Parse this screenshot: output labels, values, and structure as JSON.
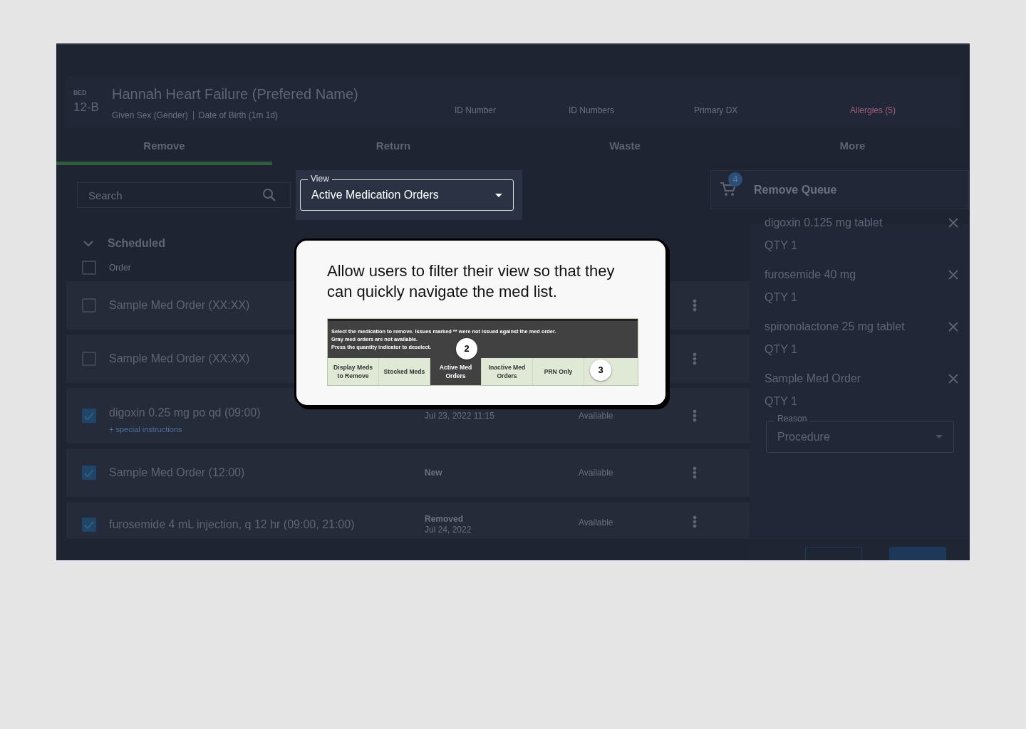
{
  "patient": {
    "bed_label": "BED",
    "bed": "12-B",
    "name": "Hannah Heart Failure (Prefered Name)",
    "sex": "Given Sex (Gender)",
    "dob": "Date of Birth (1m 1d)",
    "fields": [
      "ID Number",
      "ID Numbers",
      "Primary DX"
    ],
    "allergies": "Allergies (5)"
  },
  "tabs": [
    {
      "label": "Remove",
      "selected": true
    },
    {
      "label": "Return",
      "selected": false
    },
    {
      "label": "Waste",
      "selected": false
    },
    {
      "label": "More",
      "selected": false
    }
  ],
  "search": {
    "placeholder": "Search"
  },
  "view_filter": {
    "label": "View",
    "value": "Active Medication Orders"
  },
  "group": {
    "title": "Scheduled",
    "expanded": true,
    "column": "Order",
    "checked": false
  },
  "orders": [
    {
      "name": "Sample Med Order (XX:XX)",
      "checked": false
    },
    {
      "name": "Sample Med Order (XX:XX)",
      "checked": false
    },
    {
      "name": "digoxin 0.25 mg po qd (09:00)",
      "note": "+ special instructions",
      "checked": true,
      "date_lines": [
        "Jul 23, 2022 11:15"
      ],
      "availability": "Available"
    },
    {
      "name": "Sample Med Order (12:00)",
      "checked": true,
      "status": "New",
      "availability": "Available"
    },
    {
      "name": "furosemide 4 mL injection, q 12 hr (09:00, 21:00)",
      "checked": true,
      "status": "Removed",
      "date_lines": [
        "Jul 24, 2022"
      ],
      "availability": "Available"
    }
  ],
  "queue": {
    "count": "4",
    "title": "Remove Queue",
    "items": [
      {
        "name": "digoxin 0.125 mg tablet",
        "qty": "QTY 1"
      },
      {
        "name": "furosemide 40 mg",
        "qty": "QTY 1"
      },
      {
        "name": "spironolactone 25 mg tablet",
        "qty": "QTY 1"
      },
      {
        "name": "Sample Med Order",
        "qty": "QTY 1"
      }
    ],
    "reason": {
      "label": "Reason",
      "value": "Procedure"
    }
  },
  "callout": {
    "text": "Allow users to filter their view so that they can quickly navigate the med list.",
    "legacy_screen": {
      "instructions": [
        "Select the medication to remove. Issues marked ** were not issued against the med order.",
        "Gray med orders are not available.",
        "Press the quantity indicator to deselect."
      ],
      "tabs": [
        {
          "label": "Display Meds to Remove",
          "selected": false
        },
        {
          "label": "Stocked Meds",
          "selected": false
        },
        {
          "label": "Active Med Orders",
          "selected": true
        },
        {
          "label": "Inactive Med Orders",
          "selected": false
        },
        {
          "label": "PRN Only",
          "selected": false
        }
      ],
      "markers": [
        "2",
        "3"
      ]
    }
  }
}
